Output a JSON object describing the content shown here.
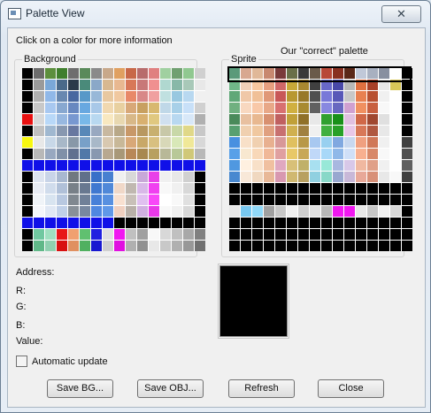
{
  "window": {
    "title": "Palette View",
    "close_label": "✕"
  },
  "instruction": "Click on a color for more information",
  "annotation": "Our \"correct\" palette",
  "background": {
    "label": "Background",
    "rows": [
      [
        "#000000",
        "#6c6c6c",
        "#5c8f3d",
        "#3f7f2d",
        "#6e6e6e",
        "#5a8a5a",
        "#8a8a8a",
        "#c8a88a",
        "#e0a060",
        "#c86848",
        "#b86c6c",
        "#e08080",
        "#a0d0a0",
        "#70a070",
        "#90c890",
        "#d0d0d0"
      ],
      [
        "#000000",
        "#9a9a9a",
        "#7aa8d8",
        "#4a6a8a",
        "#2a3a4a",
        "#4a8a7a",
        "#8aa8c8",
        "#d8b890",
        "#e8b890",
        "#d87858",
        "#c87878",
        "#f09090",
        "#b0d8d0",
        "#88b8a8",
        "#a8c8b8",
        "#e8e8e8"
      ],
      [
        "#000000",
        "#b0b0b0",
        "#90b8e8",
        "#6888b0",
        "#4868a0",
        "#5898c8",
        "#98b8d8",
        "#e8c8a0",
        "#f0c8a0",
        "#e88868",
        "#d88888",
        "#f0a0a0",
        "#c0e0e0",
        "#98c8e0",
        "#b8d8f0",
        "#f0f0f0"
      ],
      [
        "#000000",
        "#c8c8c8",
        "#a8c8f0",
        "#88a8d0",
        "#6888c0",
        "#68a8e0",
        "#a8c8e8",
        "#f0d8b0",
        "#e8d0a0",
        "#d8a878",
        "#c8a060",
        "#d8b870",
        "#c0d8e8",
        "#a8d0e8",
        "#c8e0f8",
        "#d0d0d0"
      ],
      [
        "#e81010",
        "#d8d8d8",
        "#b8d8f8",
        "#98b8e0",
        "#7898d0",
        "#78b8e8",
        "#b8d8f0",
        "#f8e8c0",
        "#e8d8b0",
        "#d8b888",
        "#d8b070",
        "#e0c880",
        "#d0e0f0",
        "#b8d8f0",
        "#d8e8f8",
        "#b0b0b0"
      ],
      [
        "#000000",
        "#c0c0c0",
        "#a0b8d0",
        "#8898b0",
        "#6878a0",
        "#5888b8",
        "#98a8c0",
        "#c8b8a0",
        "#b8a888",
        "#c89868",
        "#b89860",
        "#c8b070",
        "#c8c8a8",
        "#c8d8a8",
        "#e0d888",
        "#c8c8c8"
      ],
      [
        "#f8f810",
        "#e8e8e8",
        "#c8d8e8",
        "#a8b8c8",
        "#8898a8",
        "#78a0c8",
        "#a8b8c8",
        "#d8c8b0",
        "#c8b898",
        "#d8a878",
        "#c8a868",
        "#d8c080",
        "#d8d8b8",
        "#d8e8b8",
        "#f0e898",
        "#d8d8d8"
      ],
      [
        "#000000",
        "#b8b8b8",
        "#98a8c0",
        "#8090a8",
        "#607090",
        "#5078a8",
        "#8898b0",
        "#b8a890",
        "#a89878",
        "#b88858",
        "#a88850",
        "#b8a060",
        "#b8b898",
        "#b8c898",
        "#d0c878",
        "#b8b8b8"
      ],
      [
        "#1010e8",
        "#1010e8",
        "#1010e8",
        "#1010e8",
        "#1010e8",
        "#1010e8",
        "#1010e8",
        "#1010e8",
        "#1010e8",
        "#1010e8",
        "#1010e8",
        "#1010e8",
        "#1010e8",
        "#1010e8",
        "#1010e8",
        "#1010e8"
      ],
      [
        "#000000",
        "#dde4f0",
        "#c8d4e8",
        "#a8b8d0",
        "#707880",
        "#60708a",
        "#3870c8",
        "#4880d0",
        "#f0f0f0",
        "#d8d8d8",
        "#c8a8d8",
        "#e840e8",
        "#f0f0f0",
        "#e8e8e8",
        "#d0d0d0",
        "#000000"
      ],
      [
        "#000000",
        "#e8ecf4",
        "#d0dcec",
        "#b0c0d8",
        "#788088",
        "#687890",
        "#4078d0",
        "#5088d8",
        "#f0d8c8",
        "#c0b8b0",
        "#d8b8e8",
        "#f040f0",
        "#f8f8f8",
        "#f0f0f0",
        "#d8d8d8",
        "#000000"
      ],
      [
        "#000000",
        "#f0f4f8",
        "#d8e4f0",
        "#b8c8e0",
        "#808890",
        "#708098",
        "#4880d8",
        "#5890e0",
        "#f8e0d0",
        "#c8c0b8",
        "#e0c0f0",
        "#f848f8",
        "#ffffff",
        "#f8f8f8",
        "#e0e0e0",
        "#000000"
      ],
      [
        "#000000",
        "#f4f6fa",
        "#e0e8f4",
        "#c0d0e8",
        "#889098",
        "#7888a0",
        "#5088e0",
        "#6098e8",
        "#f0d0c0",
        "#b8b0a8",
        "#d0b0e0",
        "#e838e8",
        "#f8f8f8",
        "#f0f0f0",
        "#d8d8d8",
        "#000000"
      ],
      [
        "#1010e8",
        "#1010e8",
        "#1010e8",
        "#1010e8",
        "#1010e8",
        "#1010e8",
        "#1010e8",
        "#1010e8",
        "#000000",
        "#000000",
        "#000000",
        "#000000",
        "#000000",
        "#000000",
        "#000000",
        "#000000"
      ],
      [
        "#000000",
        "#70c8a0",
        "#a0e0c0",
        "#e81818",
        "#f0a070",
        "#60c070",
        "#2020e0",
        "#e0e0e0",
        "#f018f0",
        "#c0c0c0",
        "#a0a0a0",
        "#f8f8f8",
        "#d8d8d8",
        "#c0c0c0",
        "#a8a8a8",
        "#808080"
      ],
      [
        "#000000",
        "#60b888",
        "#90d0b0",
        "#d81010",
        "#e09060",
        "#50b060",
        "#1818d0",
        "#d0d0d0",
        "#e010e0",
        "#b0b0b0",
        "#909090",
        "#e8e8e8",
        "#c8c8c8",
        "#b0b0b0",
        "#989898",
        "#707070"
      ]
    ]
  },
  "sprite": {
    "label": "Sprite",
    "rows": [
      [
        "#5a9a7a",
        "#d8a890",
        "#e0b898",
        "#c88870",
        "#7a3a3a",
        "#6a7048",
        "#3a3a3a",
        "#6a5a4a",
        "#b84838",
        "#883020",
        "#5a2818",
        "#c0c8d8",
        "#a8b0c0",
        "#8890a0",
        "#ffffff",
        "#000000"
      ],
      [
        "#70b888",
        "#f0d0b8",
        "#f8c8a0",
        "#e8a080",
        "#d06868",
        "#c8a838",
        "#a88830",
        "#404040",
        "#6868c8",
        "#4848a8",
        "#b8b8b8",
        "#e07040",
        "#a84028",
        "#e8e8e8",
        "#d8c858",
        "#000000"
      ],
      [
        "#60a878",
        "#f0c8a8",
        "#f0c098",
        "#e09878",
        "#c85858",
        "#b89830",
        "#987828",
        "#505050",
        "#7878d8",
        "#5858b8",
        "#c8c8c8",
        "#e88050",
        "#b85030",
        "#f0f0f0",
        "#ffffff",
        "#000000"
      ],
      [
        "#70b080",
        "#f8d8c0",
        "#f8c8a8",
        "#e8a888",
        "#d87070",
        "#d0b040",
        "#a88a30",
        "#606060",
        "#8888e0",
        "#6868c0",
        "#d0a0d0",
        "#f09060",
        "#c86040",
        "#f8f8f8",
        "#ffffff",
        "#000000"
      ],
      [
        "#4a8a5a",
        "#e8c0a0",
        "#e8b890",
        "#d89070",
        "#c06060",
        "#c0a038",
        "#907028",
        "#e8e8e8",
        "#30a030",
        "#189018",
        "#e0c0e0",
        "#d06848",
        "#a04830",
        "#e0e0e0",
        "#ffffff",
        "#000000"
      ],
      [
        "#58a070",
        "#f0d0b0",
        "#f0c8a0",
        "#e0a080",
        "#c87070",
        "#d0b050",
        "#a08040",
        "#f0f0f0",
        "#40b040",
        "#28a028",
        "#e8c8e8",
        "#d87858",
        "#b05840",
        "#e8e8e8",
        "#ffffff",
        "#000000"
      ],
      [
        "#4890e0",
        "#f8e0c8",
        "#f0d0b0",
        "#e8b090",
        "#d89898",
        "#e0c060",
        "#b89848",
        "#a8c8f0",
        "#98d0f0",
        "#80a8e0",
        "#c8d8f0",
        "#f0a080",
        "#d07858",
        "#f0f0f0",
        "#ffffff",
        "#404040"
      ],
      [
        "#58a0e8",
        "#f8e8d0",
        "#f8d8b8",
        "#f0b898",
        "#e0a0a0",
        "#e8c868",
        "#c8a858",
        "#c0d8f8",
        "#a8d8f8",
        "#90b8e8",
        "#d0e0f8",
        "#f8b090",
        "#d88868",
        "#f8f8f8",
        "#ffffff",
        "#505050"
      ],
      [
        "#5098e0",
        "#fff0e0",
        "#f8e0c8",
        "#f0c0a0",
        "#e0a8c0",
        "#d8c078",
        "#c0b068",
        "#a8e0f0",
        "#98e8d8",
        "#a8b8e0",
        "#d8c8e8",
        "#f0b8a0",
        "#e0a088",
        "#f0f0f0",
        "#ffffff",
        "#606060"
      ],
      [
        "#4888d0",
        "#f8e8d8",
        "#f0d8c0",
        "#e8b898",
        "#d898b0",
        "#d0b870",
        "#b8a060",
        "#90d0e0",
        "#88d8c8",
        "#98a8d0",
        "#c8b8d8",
        "#e8a898",
        "#d89078",
        "#e8e8e8",
        "#f8f8f8",
        "#404040"
      ],
      [
        "#000000",
        "#000000",
        "#000000",
        "#000000",
        "#000000",
        "#000000",
        "#000000",
        "#000000",
        "#000000",
        "#000000",
        "#000000",
        "#000000",
        "#000000",
        "#000000",
        "#000000",
        "#000000"
      ],
      [
        "#000000",
        "#000000",
        "#000000",
        "#000000",
        "#000000",
        "#000000",
        "#000000",
        "#000000",
        "#000000",
        "#000000",
        "#000000",
        "#000000",
        "#000000",
        "#000000",
        "#000000",
        "#000000"
      ],
      [
        "#e8e8e8",
        "#78c8f0",
        "#90d8f8",
        "#a0a0a0",
        "#c8c8c8",
        "#f0f0f0",
        "#d0d0d0",
        "#e0e0e0",
        "#b8b8b8",
        "#f018f0",
        "#f018f0",
        "#e8e8e8",
        "#c8c8c8",
        "#f0f0f0",
        "#d8d8d8",
        "#000000"
      ],
      [
        "#000000",
        "#000000",
        "#000000",
        "#000000",
        "#000000",
        "#000000",
        "#000000",
        "#000000",
        "#000000",
        "#000000",
        "#000000",
        "#000000",
        "#000000",
        "#000000",
        "#000000",
        "#000000"
      ],
      [
        "#000000",
        "#000000",
        "#000000",
        "#000000",
        "#000000",
        "#000000",
        "#000000",
        "#000000",
        "#000000",
        "#000000",
        "#000000",
        "#000000",
        "#000000",
        "#000000",
        "#000000",
        "#000000"
      ],
      [
        "#000000",
        "#000000",
        "#000000",
        "#000000",
        "#000000",
        "#000000",
        "#000000",
        "#000000",
        "#000000",
        "#000000",
        "#000000",
        "#000000",
        "#000000",
        "#000000",
        "#000000",
        "#000000"
      ]
    ]
  },
  "info": {
    "address_label": "Address:",
    "r_label": "R:",
    "g_label": "G:",
    "b_label": "B:",
    "value_label": "Value:",
    "address_value": "",
    "r_value": "",
    "g_value": "",
    "b_value": "",
    "value_value": "",
    "selected_color": "#000000"
  },
  "auto_update": {
    "label": "Automatic update",
    "checked": false
  },
  "buttons": {
    "save_bg": "Save BG...",
    "save_obj": "Save OBJ...",
    "refresh": "Refresh",
    "close": "Close"
  }
}
